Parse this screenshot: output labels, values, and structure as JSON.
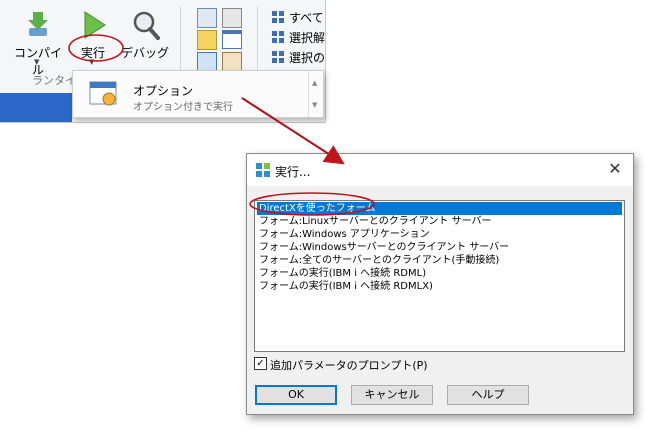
{
  "ribbon": {
    "compile_label": "コンパイル",
    "run_label": "実行",
    "debug_label": "デバッグ",
    "group_label": "ランタイ",
    "right_items": [
      "すべて",
      "選択解",
      "選択の"
    ]
  },
  "dropdown": {
    "item_title": "オプション",
    "item_desc": "オプション付きで実行"
  },
  "dialog": {
    "title": "実行...",
    "close_glyph": "✕",
    "list_items": [
      "DirectXを使ったフォーム",
      "フォーム:Linuxサーバーとのクライアント サーバー",
      "フォーム:Windows アプリケーション",
      "フォーム:Windowsサーバーとのクライアント サーバー",
      "フォーム:全てのサーバーとのクライアント(手動接続)",
      "フォームの実行(IBM i へ接続 RDML)",
      "フォームの実行(IBM i へ接続 RDMLX)"
    ],
    "selected_index": 0,
    "checkbox_label": "追加パラメータのプロンプト(P)",
    "checkbox_checked": true,
    "check_glyph": "✓",
    "ok_label": "OK",
    "cancel_label": "キャンセル",
    "help_label": "ヘルプ"
  },
  "annotation_color": "#c0141c",
  "icons": [
    "compile-icon",
    "run-icon",
    "debug-icon",
    "dialog-app-icon",
    "option-item-icon",
    "close-icon"
  ]
}
